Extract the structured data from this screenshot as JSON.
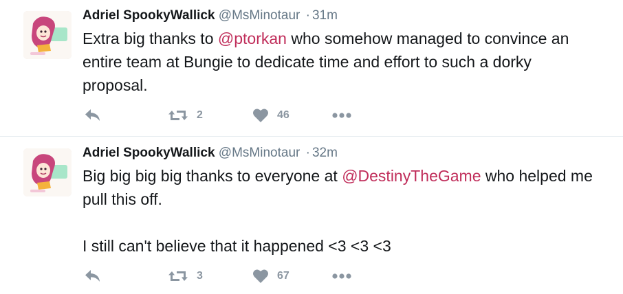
{
  "tweets": [
    {
      "fullname": "Adriel SpookyWallick",
      "username": "@MsMinotaur",
      "separator": "·",
      "time": "31m",
      "paragraphs": [
        [
          {
            "text": "Extra big thanks to ",
            "mention": false
          },
          {
            "text": "@ptorkan",
            "mention": true
          },
          {
            "text": " who somehow managed to convince an entire team at Bungie to dedicate time and effort to such a dorky proposal.",
            "mention": false
          }
        ]
      ],
      "retweets": "2",
      "likes": "46"
    },
    {
      "fullname": "Adriel SpookyWallick",
      "username": "@MsMinotaur",
      "separator": "·",
      "time": "32m",
      "paragraphs": [
        [
          {
            "text": "Big big big big thanks to everyone at ",
            "mention": false
          },
          {
            "text": "@DestinyTheGame",
            "mention": true
          },
          {
            "text": " who helped me pull this off.",
            "mention": false
          }
        ],
        [
          {
            "text": "I still can't believe that it happened <3 <3 <3",
            "mention": false
          }
        ]
      ],
      "retweets": "3",
      "likes": "67"
    }
  ],
  "icons": {
    "reply": "reply-icon",
    "retweet": "retweet-icon",
    "like": "heart-icon",
    "more": "more-dots-icon"
  },
  "colors": {
    "mention": "#c02d5a",
    "secondary_text": "#657786",
    "action_icon": "#8b96a1",
    "divider": "#e6ecf0"
  }
}
